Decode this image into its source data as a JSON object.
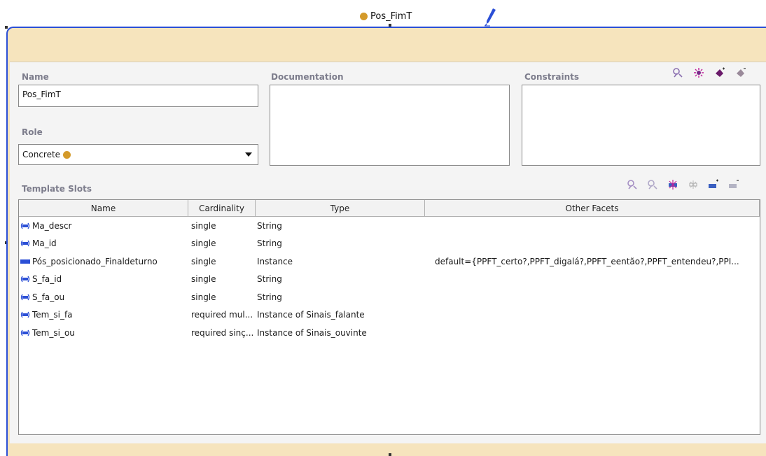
{
  "node": {
    "title": "Pos_FimT",
    "dot_color": "#d49a2a"
  },
  "form": {
    "name_label": "Name",
    "name_value": "Pos_FimT",
    "role_label": "Role",
    "role_value": "Concrete",
    "documentation_label": "Documentation",
    "constraints_label": "Constraints"
  },
  "constraints_icons": [
    "search-person-icon",
    "burst-icon",
    "diamond-add-icon",
    "diamond-remove-icon"
  ],
  "slots": {
    "label": "Template Slots",
    "icons": [
      "view-slot-icon",
      "view-top-slot-icon",
      "add-slot-icon",
      "remove-slot-icon",
      "add-override-icon",
      "remove-override-icon"
    ],
    "columns": [
      "Name",
      "Cardinality",
      "Type",
      "Other Facets"
    ],
    "rows": [
      {
        "icon": "inherited-slot-icon",
        "name": "Ma_descr",
        "cardinality": "single",
        "type": "String",
        "facets": ""
      },
      {
        "icon": "inherited-slot-icon",
        "name": "Ma_id",
        "cardinality": "single",
        "type": "String",
        "facets": ""
      },
      {
        "icon": "own-slot-icon",
        "name": "Pós_posicionado_Finaldeturno",
        "cardinality": "single",
        "type": "Instance",
        "facets": "default={PPFT_certo?,PPFT_digalá?,PPFT_eentão?,PPFT_entendeu?,PPI..."
      },
      {
        "icon": "inherited-slot-icon",
        "name": "S_fa_id",
        "cardinality": "single",
        "type": "String",
        "facets": ""
      },
      {
        "icon": "inherited-slot-icon",
        "name": "S_fa_ou",
        "cardinality": "single",
        "type": "String",
        "facets": ""
      },
      {
        "icon": "inherited-slot-icon",
        "name": "Tem_si_fa",
        "cardinality": "required mul...",
        "type": "Instance of Sinais_falante",
        "facets": ""
      },
      {
        "icon": "inherited-slot-icon",
        "name": "Tem_si_ou",
        "cardinality": "required sinç...",
        "type": "Instance of Sinais_ouvinte",
        "facets": ""
      }
    ]
  }
}
